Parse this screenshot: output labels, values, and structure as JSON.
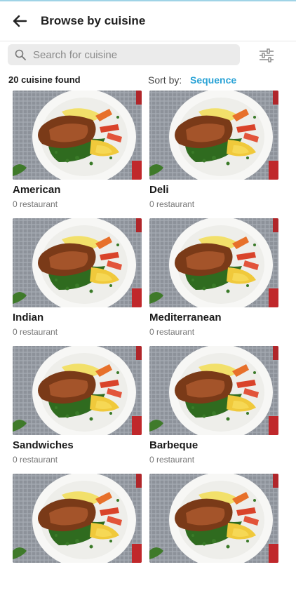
{
  "header": {
    "back_icon": "arrow-left-icon",
    "title": "Browse by cuisine"
  },
  "search": {
    "placeholder": "Search for cuisine",
    "value": "",
    "icon": "search-icon",
    "filter_icon": "filter-sliders-icon"
  },
  "results": {
    "count_label": "20 cuisine found",
    "sort_label": "Sort by:",
    "sort_value": "Sequence"
  },
  "colors": {
    "accent": "#2aa3d6",
    "search_bg": "#ebebeb",
    "text_primary": "#1f1f1f",
    "text_secondary": "#777777"
  },
  "cuisines": [
    {
      "name": "American",
      "count": "0 restaurant"
    },
    {
      "name": "Deli",
      "count": "0 restaurant"
    },
    {
      "name": "Indian",
      "count": "0 restaurant"
    },
    {
      "name": "Mediterranean",
      "count": "0 restaurant"
    },
    {
      "name": "Sandwiches",
      "count": "0 restaurant"
    },
    {
      "name": "Barbeque",
      "count": "0 restaurant"
    },
    {
      "name": "",
      "count": ""
    },
    {
      "name": "",
      "count": ""
    }
  ]
}
